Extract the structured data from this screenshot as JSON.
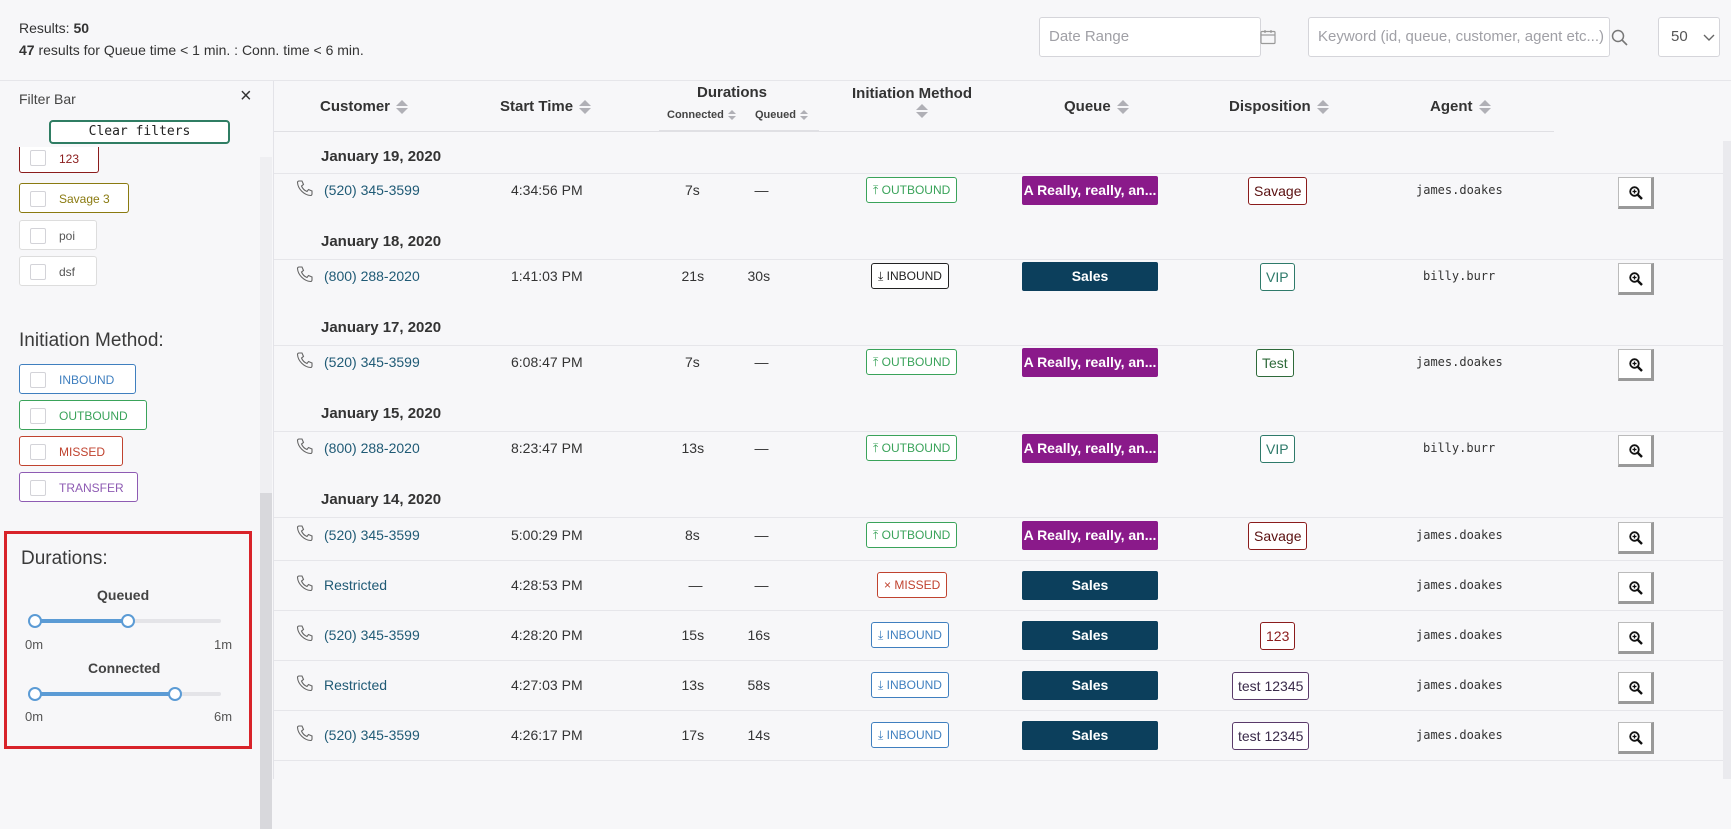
{
  "header": {
    "results_label": "Results:",
    "results_count": "50",
    "filtered_count": "47",
    "filtered_text": "results for Queue time < 1 min. : Conn. time < 6 min.",
    "date_range_placeholder": "Date Range",
    "keyword_placeholder": "Keyword (id, queue, customer, agent etc...)",
    "page_size": "50",
    "icons": {
      "calendar": "calendar-icon",
      "search": "search-icon",
      "chevron": "chevron-down-icon"
    }
  },
  "filter_bar": {
    "title": "Filter Bar",
    "close": "×",
    "clear_label": "Clear filters",
    "disposition_chips": [
      {
        "label": "123",
        "color": "#8b1c1c"
      },
      {
        "label": "Savage 3",
        "color": "#8a7a10"
      },
      {
        "label": "poi",
        "color": "#555555"
      },
      {
        "label": "dsf",
        "color": "#555555"
      }
    ],
    "initiation_title": "Initiation Method:",
    "initiation_chips": [
      {
        "label": "INBOUND",
        "color": "#3f7fbf"
      },
      {
        "label": "OUTBOUND",
        "color": "#3aa35a"
      },
      {
        "label": "MISSED",
        "color": "#c0432f"
      },
      {
        "label": "TRANSFER",
        "color": "#8e5bb3"
      }
    ],
    "durations": {
      "title": "Durations:",
      "queued": {
        "label": "Queued",
        "min_label": "0m",
        "max_label": "1m",
        "low": 0,
        "high": 0.5
      },
      "connected": {
        "label": "Connected",
        "min_label": "0m",
        "max_label": "6m",
        "low": 0,
        "high": 0.75
      }
    }
  },
  "table": {
    "columns": {
      "customer": "Customer",
      "start_time": "Start Time",
      "durations": "Durations",
      "connected": "Connected",
      "queued": "Queued",
      "initiation": "Initiation Method",
      "queue": "Queue",
      "disposition": "Disposition",
      "agent": "Agent"
    },
    "groups": [
      {
        "date": "January 19, 2020"
      },
      {
        "date": "January 18, 2020"
      },
      {
        "date": "January 17, 2020"
      },
      {
        "date": "January 15, 2020"
      },
      {
        "date": "January 14, 2020"
      }
    ],
    "rows": [
      {
        "customer": "(520) 345-3599",
        "start": "4:34:56 PM",
        "connected": "7s",
        "queued": "—",
        "method": "OUTBOUND",
        "method_glyph": "⤒",
        "queue": "A Really, really, an...",
        "disposition": "Savage",
        "agent": "james.doakes"
      },
      {
        "customer": "(800) 288-2020",
        "start": "1:41:03 PM",
        "connected": "21s",
        "queued": "30s",
        "method": "INBOUND",
        "method_glyph": "⤓",
        "queue": "Sales",
        "disposition": "VIP",
        "agent": "billy.burr"
      },
      {
        "customer": "(520) 345-3599",
        "start": "6:08:47 PM",
        "connected": "7s",
        "queued": "—",
        "method": "OUTBOUND",
        "method_glyph": "⤒",
        "queue": "A Really, really, an...",
        "disposition": "Test",
        "agent": "james.doakes"
      },
      {
        "customer": "(800) 288-2020",
        "start": "8:23:47 PM",
        "connected": "13s",
        "queued": "—",
        "method": "OUTBOUND",
        "method_glyph": "⤒",
        "queue": "A Really, really, an...",
        "disposition": "VIP",
        "agent": "billy.burr"
      },
      {
        "customer": "(520) 345-3599",
        "start": "5:00:29 PM",
        "connected": "8s",
        "queued": "—",
        "method": "OUTBOUND",
        "method_glyph": "⤒",
        "queue": "A Really, really, an...",
        "disposition": "Savage",
        "agent": "james.doakes"
      },
      {
        "customer": "Restricted",
        "start": "4:28:53 PM",
        "connected": "—",
        "queued": "—",
        "method": "MISSED",
        "method_glyph": "×",
        "queue": "Sales",
        "disposition": "",
        "agent": "james.doakes"
      },
      {
        "customer": "(520) 345-3599",
        "start": "4:28:20 PM",
        "connected": "15s",
        "queued": "16s",
        "method": "INBOUND",
        "method_glyph": "⤓",
        "queue": "Sales",
        "disposition": "123",
        "agent": "james.doakes"
      },
      {
        "customer": "Restricted",
        "start": "4:27:03 PM",
        "connected": "13s",
        "queued": "58s",
        "method": "INBOUND",
        "method_glyph": "⤓",
        "queue": "Sales",
        "disposition": "test 12345",
        "agent": "james.doakes"
      },
      {
        "customer": "(520) 345-3599",
        "start": "4:26:17 PM",
        "connected": "17s",
        "queued": "14s",
        "method": "INBOUND",
        "method_glyph": "⤓",
        "queue": "Sales",
        "disposition": "test 12345",
        "agent": "james.doakes"
      }
    ],
    "colors": {
      "queue_purple": "#8a1a8a",
      "queue_navy": "#0c3f5c",
      "outbound": "#3aa35a",
      "inbound": "#3f7fbf",
      "inbound_dark": "#222222",
      "missed": "#c0432f"
    }
  }
}
